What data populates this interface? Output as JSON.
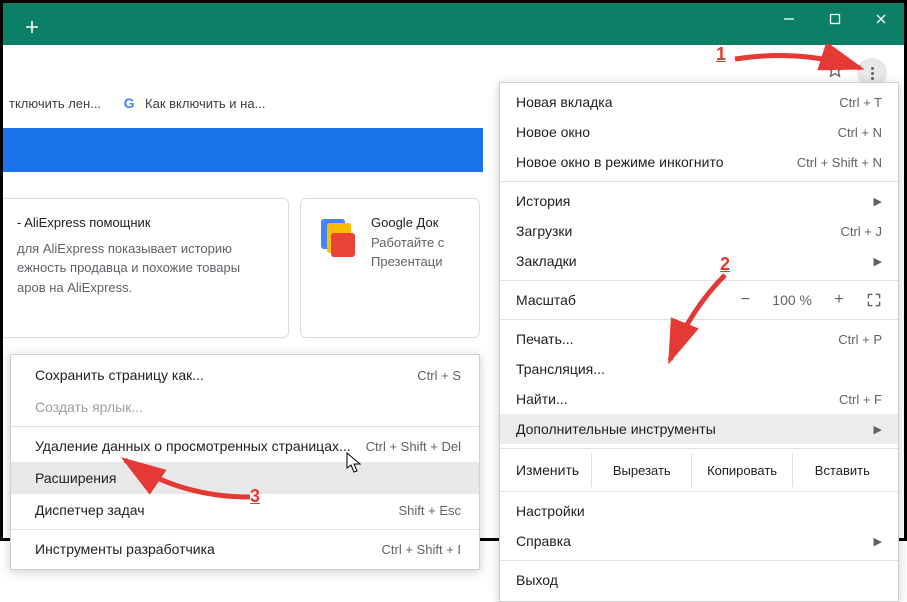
{
  "window": {
    "minimize": "—",
    "maximize": "▢",
    "close": "×"
  },
  "bookmarks": {
    "item1": "тключить лен...",
    "item2": "Как включить и на...",
    "g_letter": "G"
  },
  "card1": {
    "title": "- AliExpress помощник",
    "line1": "для AliExpress показывает историю",
    "line2": "ежность продавца и похожие товары",
    "line3": "аров на AliExpress."
  },
  "card2": {
    "title": "Google Док",
    "line1": "Работайте с",
    "line2": "Презентаци"
  },
  "menu": {
    "new_tab": "Новая вкладка",
    "new_tab_sc": "Ctrl + T",
    "new_window": "Новое окно",
    "new_window_sc": "Ctrl + N",
    "incognito": "Новое окно в режиме инкогнито",
    "incognito_sc": "Ctrl + Shift + N",
    "history": "История",
    "downloads": "Загрузки",
    "downloads_sc": "Ctrl + J",
    "bookmarks": "Закладки",
    "zoom_label": "Масштаб",
    "zoom_minus": "−",
    "zoom_value": "100 %",
    "zoom_plus": "+",
    "print": "Печать...",
    "print_sc": "Ctrl + P",
    "cast": "Трансляция...",
    "find": "Найти...",
    "find_sc": "Ctrl + F",
    "more_tools": "Дополнительные инструменты",
    "edit_label": "Изменить",
    "cut": "Вырезать",
    "copy": "Копировать",
    "paste": "Вставить",
    "settings": "Настройки",
    "help": "Справка",
    "exit": "Выход"
  },
  "submenu": {
    "save_as": "Сохранить страницу как...",
    "save_as_sc": "Ctrl + S",
    "create_shortcut": "Создать ярлык...",
    "clear_data": "Удаление данных о просмотренных страницах...",
    "clear_data_sc": "Ctrl + Shift + Del",
    "extensions": "Расширения",
    "task_manager": "Диспетчер задач",
    "task_manager_sc": "Shift + Esc",
    "dev_tools": "Инструменты разработчика",
    "dev_tools_sc": "Ctrl + Shift + I"
  },
  "annotations": {
    "n1": "1",
    "n2": "2",
    "n3": "3"
  }
}
